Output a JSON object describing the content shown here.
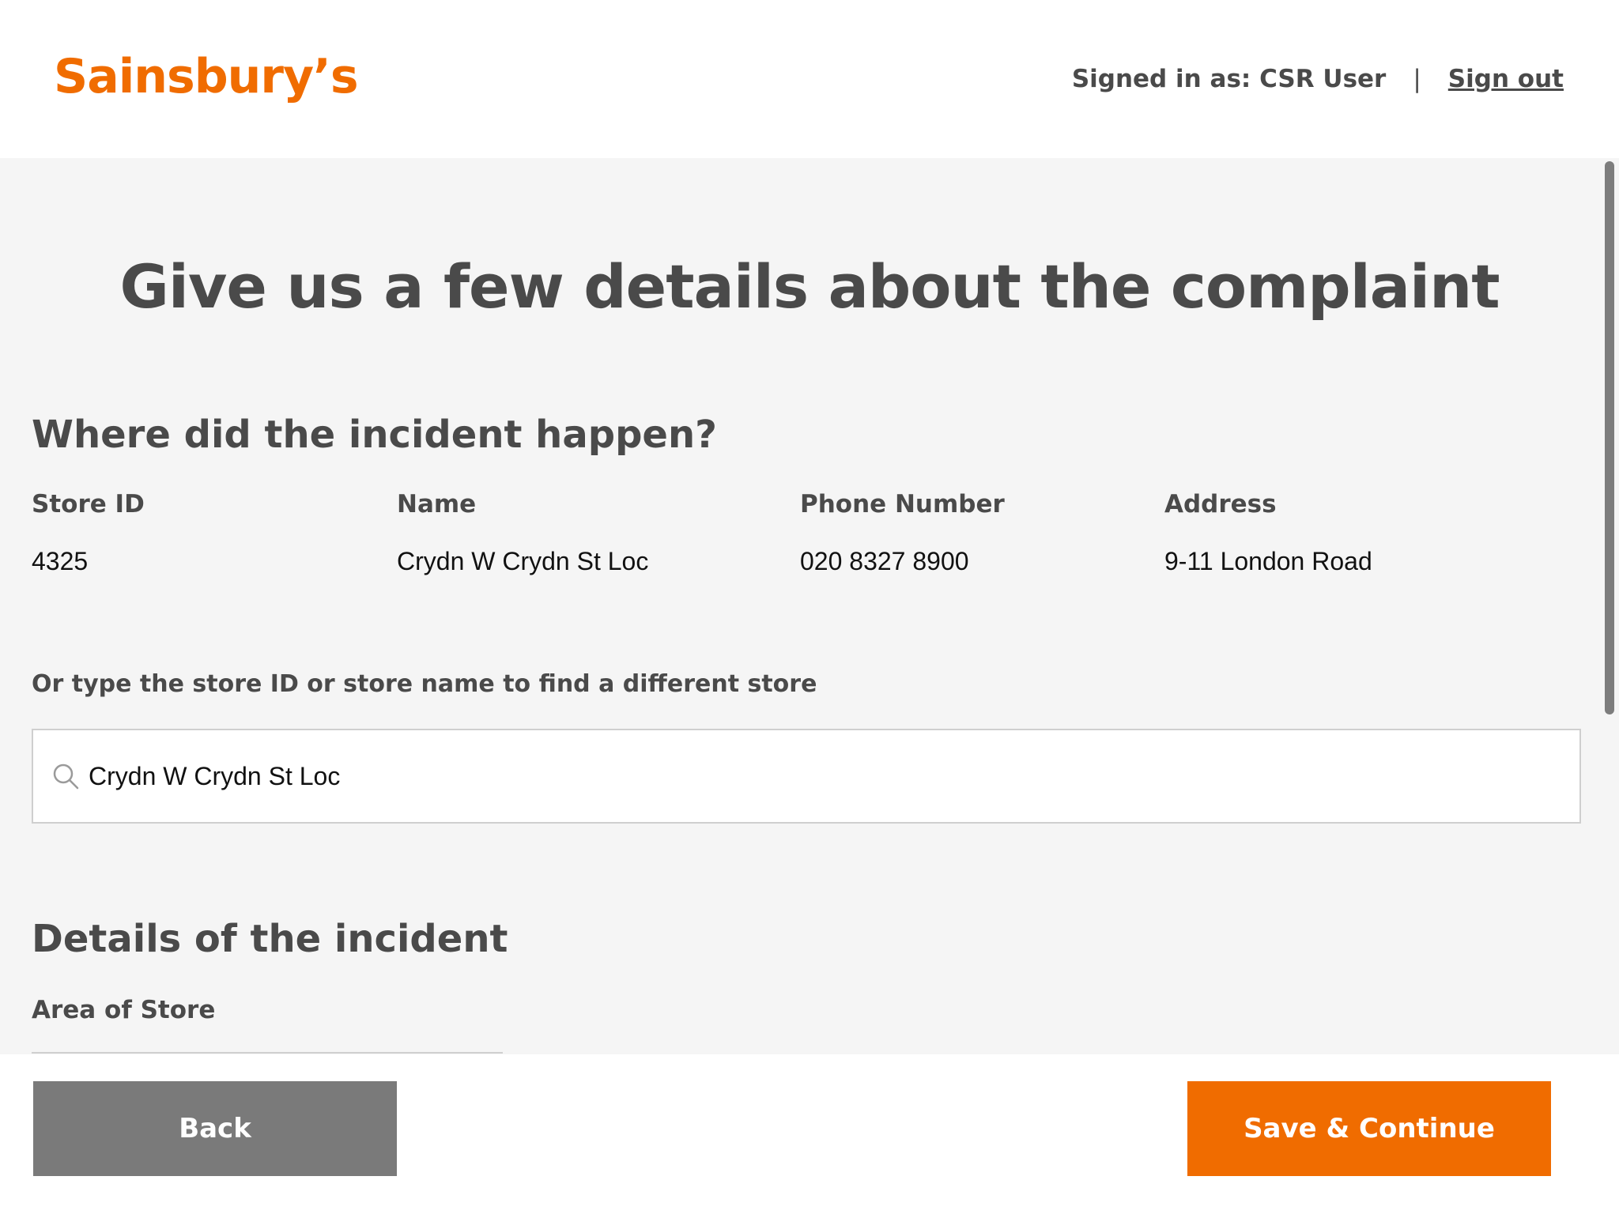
{
  "header": {
    "logo": "Sainsbury’s",
    "signed_in_text": "Signed in as: CSR User",
    "separator": "|",
    "sign_out": "Sign out"
  },
  "page_title": "Give us a few details about the complaint",
  "incident_location": {
    "title": "Where did the incident happen?",
    "columns": [
      {
        "label": "Store ID",
        "value": "4325"
      },
      {
        "label": "Name",
        "value": "Crydn W Crydn St Loc"
      },
      {
        "label": "Phone Number",
        "value": "020 8327 8900"
      },
      {
        "label": "Address",
        "value": "9-11 London Road"
      }
    ],
    "search_hint": "Or type the store ID or store name to find a different store",
    "search_value": "Crydn W Crydn St Loc"
  },
  "incident_details": {
    "title": "Details of the incident",
    "area_label": "Area of Store"
  },
  "footer": {
    "back_label": "Back",
    "save_label": "Save & Continue"
  },
  "colors": {
    "brand": "#f06c00",
    "text": "#4a4a4a",
    "back_button": "#7a7a7a"
  }
}
